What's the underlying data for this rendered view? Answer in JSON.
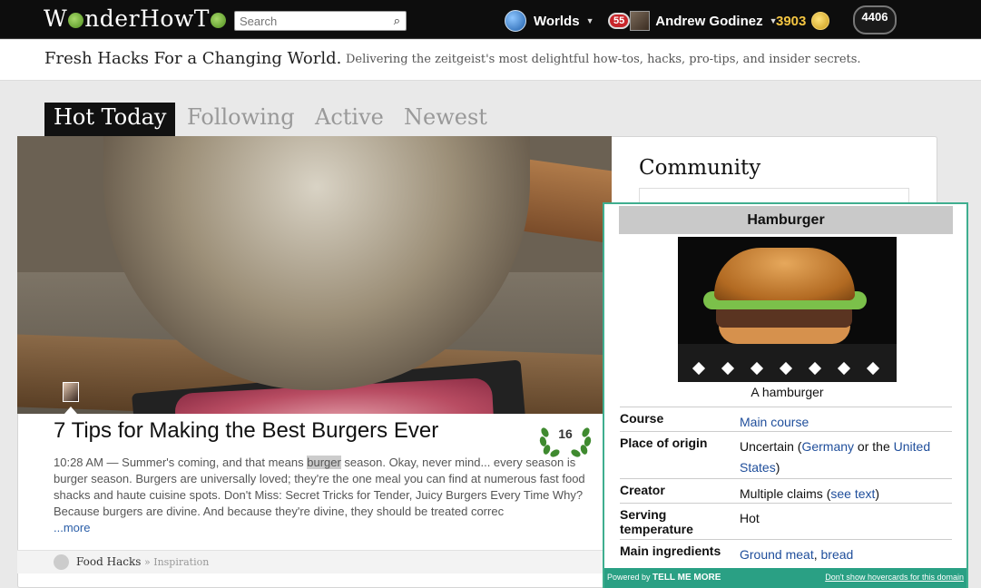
{
  "header": {
    "logo_text": "WonderHowTo",
    "search_placeholder": "Search",
    "worlds_label": "Worlds",
    "notification_count": "55",
    "user_name": "Andrew Godinez",
    "points": "3903",
    "rank": "4406"
  },
  "tagline": {
    "main": "Fresh Hacks For a Changing World.",
    "sub": "Delivering the zeitgeist's most delightful how-tos, hacks, pro-tips, and insider secrets."
  },
  "tabs": [
    {
      "label": "Hot Today",
      "active": true
    },
    {
      "label": "Following",
      "active": false
    },
    {
      "label": "Active",
      "active": false
    },
    {
      "label": "Newest",
      "active": false
    }
  ],
  "article": {
    "title": "7 Tips for Making the Best Burgers Ever",
    "score": "16",
    "time": "10:28 AM",
    "excerpt_before": " — Summer's coming, and that means ",
    "excerpt_highlight": "burger",
    "excerpt_after": " season. Okay, never mind... every season is burger season. Burgers are universally loved; they're the one meal you can find at numerous fast food shacks and haute cuisine spots. Don't Miss: Secret Tricks for Tender, Juicy Burgers Every Time Why? Because burgers are divine. And because they're divine, they should be treated correc",
    "more_label": "...more",
    "category": "Food Hacks",
    "subcategory": "» Inspiration"
  },
  "sidebar": {
    "title": "Community"
  },
  "hovercard": {
    "title": "Hamburger",
    "caption": "A hamburger",
    "rows": [
      {
        "label": "Course",
        "v1": "Main course"
      },
      {
        "label": "Place of origin",
        "v_pre": "Uncertain (",
        "v_link1": "Germany",
        "v_mid": " or the ",
        "v_link2": "United States",
        "v_post": ")"
      },
      {
        "label": "Creator",
        "v_pre": "Multiple claims (",
        "v_link1": "see text",
        "v_post": ")"
      },
      {
        "label": "Serving temperature",
        "v_pre": "Hot"
      },
      {
        "label": "Main ingredients",
        "v_link1": "Ground meat",
        "v_mid": ", ",
        "v_link2": "bread"
      }
    ],
    "powered_by": "Powered by",
    "powered_brand": "TELL ME MORE",
    "dont_show": "Don't show hovercards for this domain"
  },
  "colors": {
    "accent_green": "#2aa084",
    "link_blue": "#1f4e9b",
    "notification_red": "#c8262b",
    "points_gold": "#f4c542"
  }
}
